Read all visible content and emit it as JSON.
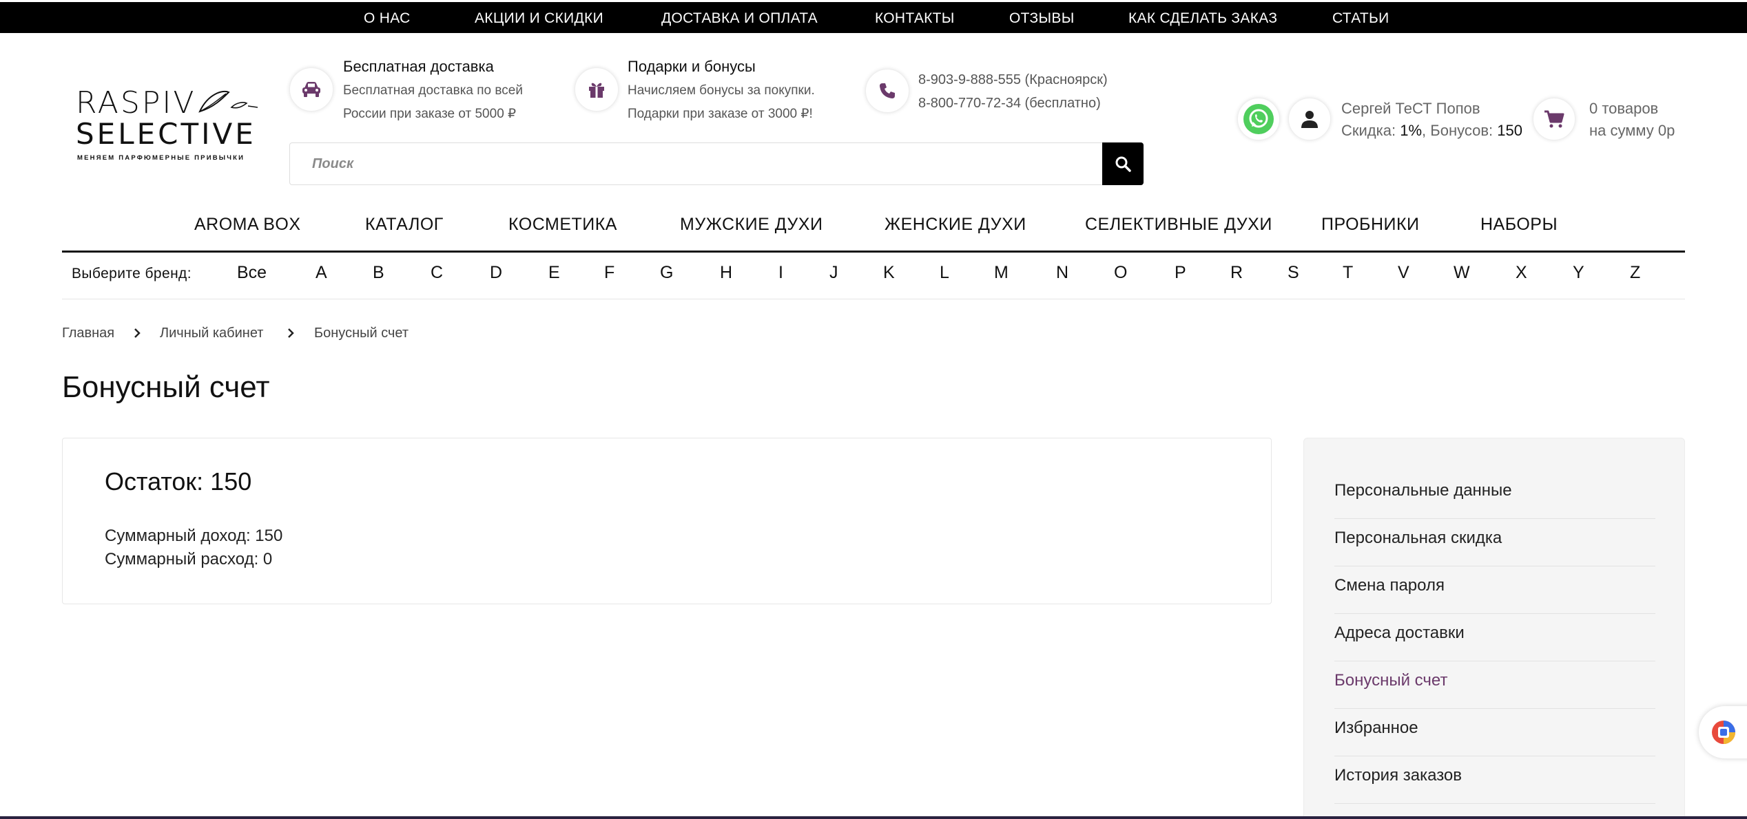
{
  "topnav": [
    "О НАС",
    "АКЦИИ И СКИДКИ",
    "ДОСТАВКА И ОПЛАТА",
    "КОНТАКТЫ",
    "ОТЗЫВЫ",
    "КАК СДЕЛАТЬ ЗАКАЗ",
    "СТАТЬИ"
  ],
  "logo": {
    "line1": "RASPIV",
    "line2": "SELECTIVE",
    "tagline": "МЕНЯЕМ ПАРФЮМЕРНЫЕ ПРИВЫЧКИ"
  },
  "info": {
    "delivery": {
      "title": "Бесплатная доставка",
      "line1": "Бесплатная доставка по всей",
      "line2": "России при заказе от 5000 ₽",
      "icon": "car-icon"
    },
    "gifts": {
      "title": "Подарки и бонусы",
      "line1": "Начисляем бонусы за покупки.",
      "line2": "Подарки при заказе от 3000 ₽!",
      "icon": "gift-icon"
    },
    "phones": {
      "line1": "8-903-9-888-555 (Красноярск)",
      "line2": "8-800-770-72-34 (бесплатно)",
      "icon": "phone-icon"
    }
  },
  "search": {
    "placeholder": "Поиск"
  },
  "user": {
    "name": "Сергей ТеСТ Попов",
    "discount_label": "Скидка:",
    "discount_value": "1%",
    "bonus_label": "Бонусов:",
    "bonus_value": "150"
  },
  "cart": {
    "line1": "0 товаров",
    "line2": "на сумму 0р"
  },
  "mainnav": [
    "AROMA BOX",
    "КАТАЛОГ",
    "КОСМЕТИКА",
    "МУЖСКИЕ ДУХИ",
    "ЖЕНСКИЕ ДУХИ",
    "СЕЛЕКТИВНЫЕ ДУХИ",
    "ПРОБНИКИ",
    "НАБОРЫ"
  ],
  "brands": {
    "label": "Выберите бренд:",
    "letters": [
      "Все",
      "A",
      "B",
      "C",
      "D",
      "E",
      "F",
      "G",
      "H",
      "I",
      "J",
      "K",
      "L",
      "M",
      "N",
      "O",
      "P",
      "R",
      "S",
      "T",
      "V",
      "W",
      "X",
      "Y",
      "Z"
    ]
  },
  "breadcrumb": [
    "Главная",
    "Личный кабинет",
    "Бонусный счет"
  ],
  "page_title": "Бонусный счет",
  "bonus": {
    "remain": "Остаток: 150",
    "income": "Суммарный доход: 150",
    "expense": "Суммарный расход: 0"
  },
  "sidebar": {
    "items": [
      "Персональные данные",
      "Персональная скидка",
      "Смена пароля",
      "Адреса доставки",
      "Бонусный счет",
      "Избранное",
      "История заказов"
    ],
    "active_index": 4
  },
  "colors": {
    "accent": "#6b3a6b",
    "topbar": "#000000",
    "whatsapp": "#4fce5d"
  }
}
